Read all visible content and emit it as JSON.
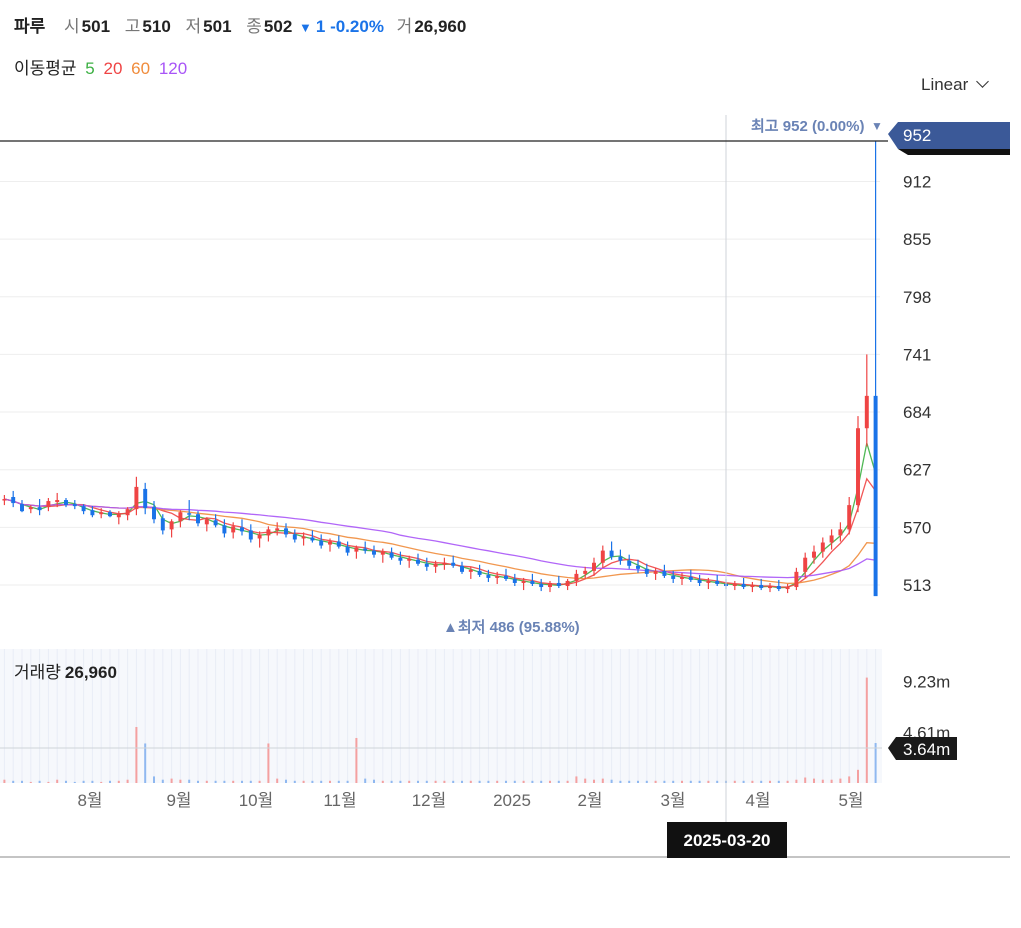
{
  "header": {
    "symbol": "파루",
    "open_label": "시",
    "open": "501",
    "high_label": "고",
    "high": "510",
    "low_label": "저",
    "low": "501",
    "close_label": "종",
    "close": "502",
    "change": "1 -0.20%",
    "volume_label": "거",
    "volume": "26,960"
  },
  "moving_avg": {
    "label": "이동평균",
    "periods": [
      {
        "text": "5",
        "color": "#3cb043"
      },
      {
        "text": "20",
        "color": "#ef4444"
      },
      {
        "text": "60",
        "color": "#f08c3c"
      },
      {
        "text": "120",
        "color": "#a855f7"
      }
    ]
  },
  "scale_selector": {
    "label": "Linear"
  },
  "annotations": {
    "high": "최고 952 (0.00%)",
    "low": "▲최저 486 (95.88%)"
  },
  "volume_panel": {
    "label": "거래량",
    "value": "26,960"
  },
  "crosshair": {
    "date": "2025-03-20",
    "volume_value": "3.64m"
  },
  "colors": {
    "up": "#ef4444",
    "down": "#1a73e8",
    "current_price_tag": "#3b5998"
  },
  "chart_data": {
    "type": "candlestick",
    "price_axis": {
      "ticks": [
        "952",
        "912",
        "855",
        "798",
        "741",
        "684",
        "627",
        "570",
        "513"
      ],
      "current_price": "952",
      "range": [
        466,
        987
      ]
    },
    "volume_axis": {
      "ticks": [
        "9.23m",
        "4.61m"
      ],
      "range": [
        0,
        11.2
      ]
    },
    "x_ticks": [
      "8월",
      "9월",
      "10월",
      "11월",
      "12월",
      "2025",
      "2월",
      "3월",
      "4월",
      "5월"
    ],
    "candles": [
      [
        597,
        602,
        592,
        598
      ],
      [
        600,
        606,
        590,
        594
      ],
      [
        593,
        597,
        585,
        586
      ],
      [
        588,
        592,
        584,
        590
      ],
      [
        590,
        598,
        582,
        587
      ],
      [
        590,
        599,
        586,
        596
      ],
      [
        595,
        604,
        590,
        597
      ],
      [
        597,
        599,
        590,
        592
      ],
      [
        593,
        597,
        588,
        591
      ],
      [
        591,
        593,
        583,
        586
      ],
      [
        587,
        591,
        580,
        582
      ],
      [
        583,
        589,
        579,
        585
      ],
      [
        585,
        587,
        580,
        581
      ],
      [
        580,
        586,
        573,
        583
      ],
      [
        582,
        590,
        577,
        588
      ],
      [
        588,
        620,
        582,
        610
      ],
      [
        608,
        614,
        583,
        589
      ],
      [
        590,
        596,
        574,
        578
      ],
      [
        579,
        583,
        563,
        567
      ],
      [
        568,
        578,
        560,
        576
      ],
      [
        576,
        587,
        570,
        585
      ],
      [
        584,
        597,
        577,
        583
      ],
      [
        583,
        586,
        571,
        574
      ],
      [
        573,
        580,
        566,
        578
      ],
      [
        577,
        583,
        570,
        572
      ],
      [
        572,
        578,
        560,
        564
      ],
      [
        565,
        575,
        559,
        571
      ],
      [
        570,
        578,
        562,
        566
      ],
      [
        567,
        573,
        555,
        558
      ],
      [
        559,
        566,
        550,
        563
      ],
      [
        562,
        571,
        556,
        568
      ],
      [
        567,
        575,
        562,
        569
      ],
      [
        569,
        574,
        560,
        563
      ],
      [
        563,
        568,
        555,
        558
      ],
      [
        559,
        565,
        552,
        561
      ],
      [
        560,
        567,
        555,
        557
      ],
      [
        557,
        563,
        549,
        552
      ],
      [
        553,
        559,
        546,
        556
      ],
      [
        556,
        562,
        549,
        551
      ],
      [
        551,
        556,
        542,
        545
      ],
      [
        546,
        552,
        539,
        550
      ],
      [
        549,
        556,
        544,
        547
      ],
      [
        547,
        552,
        540,
        543
      ],
      [
        543,
        549,
        535,
        546
      ],
      [
        545,
        550,
        538,
        540
      ],
      [
        540,
        546,
        533,
        537
      ],
      [
        537,
        542,
        530,
        539
      ],
      [
        538,
        544,
        532,
        534
      ],
      [
        534,
        540,
        527,
        531
      ],
      [
        531,
        537,
        525,
        534
      ],
      [
        533,
        540,
        528,
        535
      ],
      [
        535,
        542,
        530,
        532
      ],
      [
        532,
        536,
        524,
        526
      ],
      [
        526,
        531,
        519,
        528
      ],
      [
        527,
        533,
        521,
        523
      ],
      [
        523,
        528,
        516,
        520
      ],
      [
        520,
        526,
        514,
        522
      ],
      [
        522,
        529,
        517,
        519
      ],
      [
        519,
        524,
        512,
        515
      ],
      [
        515,
        520,
        508,
        517
      ],
      [
        517,
        524,
        512,
        514
      ],
      [
        514,
        519,
        507,
        511
      ],
      [
        511,
        517,
        506,
        515
      ],
      [
        515,
        522,
        510,
        512
      ],
      [
        512,
        519,
        508,
        517
      ],
      [
        517,
        528,
        512,
        524
      ],
      [
        524,
        531,
        519,
        527
      ],
      [
        527,
        540,
        522,
        535
      ],
      [
        535,
        552,
        530,
        547
      ],
      [
        547,
        556,
        538,
        541
      ],
      [
        541,
        548,
        533,
        537
      ],
      [
        537,
        543,
        529,
        532
      ],
      [
        532,
        538,
        525,
        529
      ],
      [
        529,
        534,
        521,
        524
      ],
      [
        524,
        530,
        518,
        527
      ],
      [
        527,
        533,
        520,
        522
      ],
      [
        522,
        527,
        515,
        519
      ],
      [
        519,
        525,
        513,
        521
      ],
      [
        521,
        528,
        516,
        518
      ],
      [
        518,
        523,
        512,
        515
      ],
      [
        515,
        520,
        509,
        517
      ],
      [
        517,
        523,
        512,
        514
      ],
      [
        514,
        519,
        509,
        512
      ],
      [
        512,
        517,
        508,
        514
      ],
      [
        514,
        520,
        509,
        511
      ],
      [
        511,
        516,
        506,
        513
      ],
      [
        513,
        519,
        508,
        510
      ],
      [
        510,
        515,
        506,
        512
      ],
      [
        512,
        518,
        507,
        509
      ],
      [
        509,
        514,
        505,
        511
      ],
      [
        511,
        530,
        508,
        526
      ],
      [
        526,
        545,
        520,
        540
      ],
      [
        540,
        552,
        534,
        546
      ],
      [
        546,
        560,
        540,
        555
      ],
      [
        555,
        568,
        548,
        562
      ],
      [
        562,
        575,
        556,
        568
      ],
      [
        568,
        600,
        563,
        592
      ],
      [
        592,
        680,
        585,
        668
      ],
      [
        668,
        741,
        650,
        700
      ],
      [
        700,
        952,
        690,
        502
      ]
    ],
    "volume": [
      0.3,
      0.2,
      0.2,
      0.1,
      0.2,
      0.1,
      0.3,
      0.2,
      0.1,
      0.2,
      0.2,
      0.1,
      0.2,
      0.2,
      0.3,
      5.1,
      3.6,
      0.6,
      0.3,
      0.4,
      0.3,
      0.3,
      0.2,
      0.2,
      0.2,
      0.2,
      0.2,
      0.2,
      0.2,
      0.2,
      3.6,
      0.4,
      0.3,
      0.2,
      0.2,
      0.2,
      0.2,
      0.2,
      0.2,
      0.2,
      4.1,
      0.4,
      0.3,
      0.2,
      0.2,
      0.2,
      0.2,
      0.2,
      0.2,
      0.2,
      0.2,
      0.2,
      0.2,
      0.2,
      0.2,
      0.2,
      0.2,
      0.2,
      0.2,
      0.2,
      0.2,
      0.2,
      0.2,
      0.2,
      0.2,
      0.6,
      0.4,
      0.3,
      0.4,
      0.3,
      0.2,
      0.2,
      0.2,
      0.2,
      0.2,
      0.2,
      0.2,
      0.2,
      0.2,
      0.2,
      0.2,
      0.2,
      0.2,
      0.2,
      0.2,
      0.2,
      0.2,
      0.2,
      0.2,
      0.2,
      0.3,
      0.5,
      0.4,
      0.3,
      0.3,
      0.4,
      0.6,
      1.2,
      9.6,
      3.64
    ]
  }
}
